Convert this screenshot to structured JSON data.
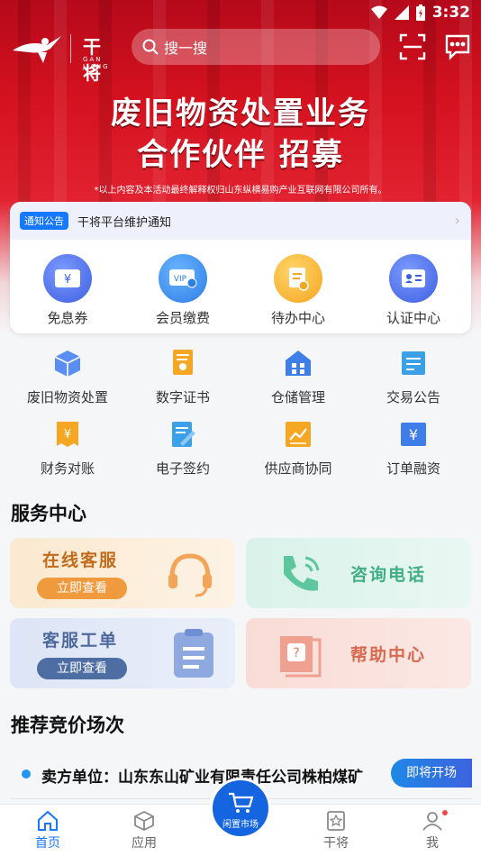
{
  "status_bar": {
    "time": "3:32"
  },
  "header": {
    "logo_name": "干将",
    "logo_sub": "GAN JIANG",
    "search_placeholder": "搜一搜"
  },
  "banner": {
    "line1": "废旧物资处置业务",
    "line2": "合作伙伴 招募",
    "note": "*以上内容及本活动最终解释权归山东纵横易购产业互联网有限公司所有。"
  },
  "notice": {
    "badge": "通知公告",
    "text": "干将平台维护通知"
  },
  "quick_actions": [
    {
      "label": "免息券",
      "icon": "coupon-icon"
    },
    {
      "label": "会员缴费",
      "icon": "vip-card-icon"
    },
    {
      "label": "待办中心",
      "icon": "todo-icon"
    },
    {
      "label": "认证中心",
      "icon": "id-card-icon"
    }
  ],
  "services": [
    {
      "label": "废旧物资处置",
      "icon": "box-icon"
    },
    {
      "label": "数字证书",
      "icon": "certificate-icon"
    },
    {
      "label": "仓储管理",
      "icon": "warehouse-icon"
    },
    {
      "label": "交易公告",
      "icon": "announcement-icon"
    },
    {
      "label": "财务对账",
      "icon": "bill-icon"
    },
    {
      "label": "电子签约",
      "icon": "sign-icon"
    },
    {
      "label": "供应商协同",
      "icon": "chart-icon"
    },
    {
      "label": "订单融资",
      "icon": "finance-icon"
    }
  ],
  "service_center": {
    "title": "服务中心",
    "online_service": {
      "title": "在线客服",
      "button": "立即查看"
    },
    "hotline": {
      "title": "咨询电话"
    },
    "ticket": {
      "title": "客服工单",
      "button": "立即查看"
    },
    "help": {
      "title": "帮助中心"
    }
  },
  "recommend": {
    "title": "推荐竞价场次",
    "item": {
      "text": "卖方单位：山东东山矿业有限责任公司株柏煤矿",
      "tag": "即将开场"
    }
  },
  "tabbar": {
    "home": "首页",
    "apps": "应用",
    "market": "闲置市场",
    "ganjiang": "干将",
    "me": "我"
  },
  "colors": {
    "primary": "#1677ff",
    "banner_red": "#d5121f"
  }
}
